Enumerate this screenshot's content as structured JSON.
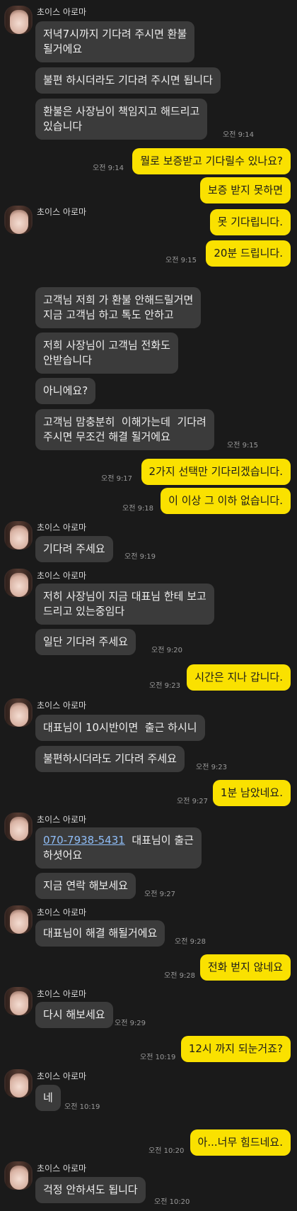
{
  "sender_name": "초이스 아로마",
  "messages": {
    "m1": "저녁7시까지 기다려 주시면 환불\n될거에요",
    "m2": "불편 하시더라도 기다려 주시면 됩니다",
    "m3": "환불은 사장님이 책임지고 해드리고\n있습니다",
    "m4": "뭘로 보증받고 기다릴수 있나요?",
    "m5": "보증 받지 못하면",
    "m6": "못 기다립니다.",
    "m7": "20분 드립니다.",
    "m8": "고객님 저희 가 환불 안해드릴거면\n지금 고객님 하고 톡도 안하고",
    "m9": "저희 사장님이 고객님 전화도\n안받습니다",
    "m10": "아니에요?",
    "m11": "고객님 맘충분히  이해가는데  기다려\n주시면 무조건 해결 될거에요",
    "m12": "2가지 선택만 기다리겠습니다.",
    "m13": "이 이상 그 이하 없습니다.",
    "m14": "기다려 주세요",
    "m15": "저히 사장님이 지금 대표님 한테 보고\n드리고 있는중임다",
    "m16": "일단 기다려 주세요",
    "m17": "시간은 지나 갑니다.",
    "m18": "대표님이 10시반이면  출근 하시니",
    "m19": "불편하시더라도 기다려 주세요",
    "m20": "1분 남았네요.",
    "m21_phone": "070-7938-5431",
    "m21_rest": "  대표님이 출근",
    "m21_line2": "하셧어요",
    "m22": "지금 연락 해보세요",
    "m23": "대표님이 해결 해될거에요",
    "m24": "전화 벋지 않네요",
    "m25": "다시 해보세요",
    "m26": "12시 까지 되눈거죠?",
    "m27": "네",
    "m28": "아...너무 힘드네요.",
    "m29": "걱정 안하셔도 됩니다"
  },
  "times": {
    "t914": "오전 9:14",
    "t915": "오전 9:15",
    "t917": "오전 9:17",
    "t918": "오전 9:18",
    "t919": "오전 9:19",
    "t920": "오전 9:20",
    "t923": "오전 9:23",
    "t927": "오전 9:27",
    "t928": "오전 9:28",
    "t929": "오전 9:29",
    "t1019": "오전 10:19",
    "t1020": "오전 10:20"
  },
  "colors": {
    "background": "#1a1a1a",
    "incoming_bubble": "#3b3b3b",
    "outgoing_bubble": "#fae100",
    "link": "#8fbdf7"
  }
}
